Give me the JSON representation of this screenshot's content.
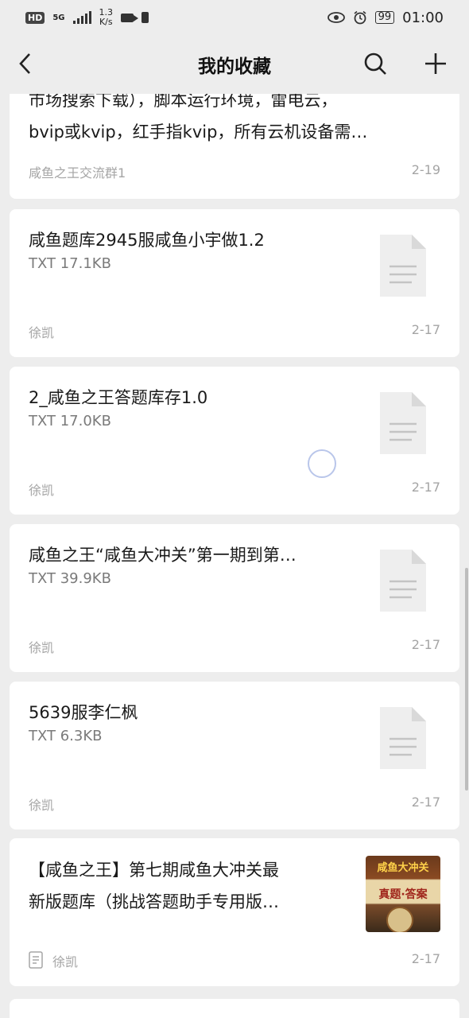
{
  "status_bar": {
    "hd": "HD",
    "network": "5G",
    "speed_value": "1.3",
    "speed_unit": "K/s",
    "battery": "99",
    "time": "01:00"
  },
  "header": {
    "title": "我的收藏"
  },
  "items": [
    {
      "text_line1": "市场搜索下载），脚本运行环境，雷电云，",
      "text_line2": "bvip或kvip，红手指kvip，所有云机设备需…",
      "source": "咸鱼之王交流群1",
      "date": "2-19"
    },
    {
      "title": "咸鱼题库2945服咸鱼小宇做1.2",
      "meta": "TXT 17.1KB",
      "source": "徐凯",
      "date": "2-17"
    },
    {
      "title": "2_咸鱼之王答题库存1.0",
      "meta": "TXT 17.0KB",
      "source": "徐凯",
      "date": "2-17"
    },
    {
      "title": "咸鱼之王“咸鱼大冲关”第一期到第…",
      "meta": "TXT 39.9KB",
      "source": "徐凯",
      "date": "2-17"
    },
    {
      "title": "5639服李仁枫",
      "meta": "TXT 6.3KB",
      "source": "徐凯",
      "date": "2-17"
    },
    {
      "title_line1": "【咸鱼之王】第七期咸鱼大冲关最",
      "title_line2": "新版题库（挑战答题助手专用版…",
      "thumb_title": "咸鱼大冲关",
      "thumb_subtitle": "真题·答案",
      "source": "徐凯",
      "date": "2-17"
    }
  ]
}
